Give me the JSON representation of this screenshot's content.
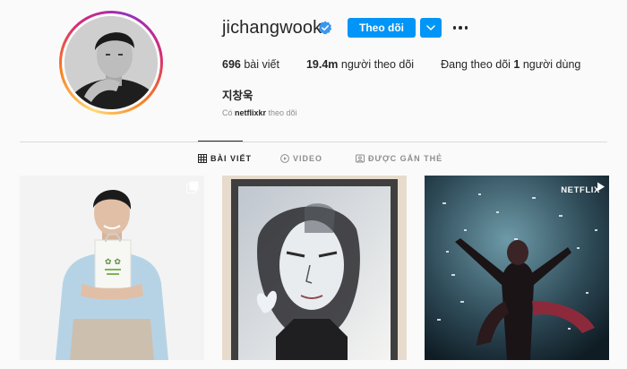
{
  "profile": {
    "username": "jichangwook",
    "follow_label": "Theo dõi",
    "fullname": "지창욱",
    "followed_by_prefix": "Có ",
    "followed_by_user": "netflixkr",
    "followed_by_suffix": " theo dõi"
  },
  "stats": {
    "posts_count": "696",
    "posts_label": " bài viết",
    "followers_count": "19.4m",
    "followers_label": " người theo dõi",
    "following_prefix": "Đang theo dõi ",
    "following_count": "1",
    "following_label": " người dùng"
  },
  "tabs": [
    {
      "label": "BÀI VIẾT",
      "icon": "grid-icon",
      "active": true
    },
    {
      "label": "VIDEO",
      "icon": "video-icon",
      "active": false
    },
    {
      "label": "ĐƯỢC GẮN THẺ",
      "icon": "tagged-icon",
      "active": false
    }
  ],
  "posts": [
    {
      "badge": "multi-photo-icon"
    },
    {
      "badge": ""
    },
    {
      "badge": "video-icon",
      "overlay_text": "NETFLIX"
    }
  ],
  "colors": {
    "accent": "#0095f6",
    "text": "#262626",
    "muted": "#8e8e8e",
    "border": "#dbdbdb",
    "background": "#fafafa"
  }
}
